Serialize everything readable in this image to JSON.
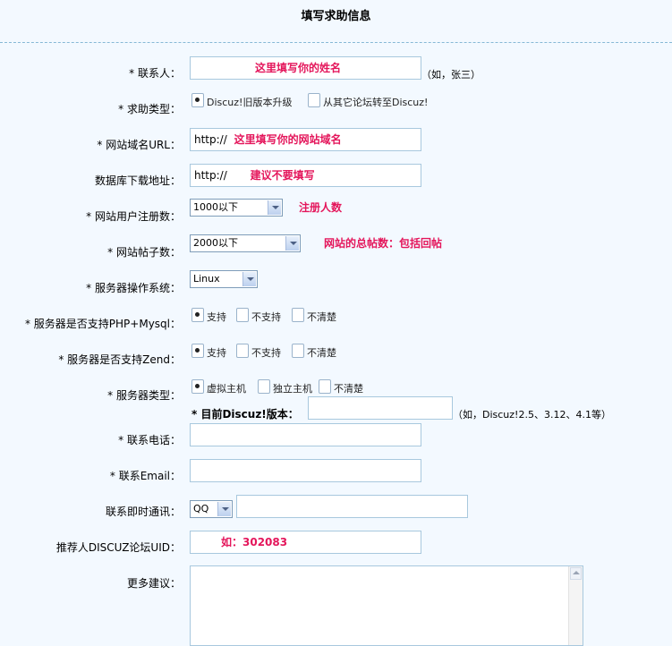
{
  "page": {
    "title": "填写求助信息"
  },
  "form": {
    "contact_name": {
      "label": "* 联系人：",
      "hint": "这里填写你的姓名",
      "note": "（如，张三）"
    },
    "help_type": {
      "label": "* 求助类型：",
      "options": [
        "Discuz!旧版本升级",
        "从其它论坛转至Discuz!"
      ],
      "selected": 0
    },
    "site_url": {
      "label": "* 网站域名URL：",
      "prefix": "http://",
      "hint": "这里填写你的网站域名"
    },
    "db_download": {
      "label": "数据库下载地址：",
      "prefix": "http://",
      "hint": "建议不要填写"
    },
    "user_count": {
      "label": "* 网站用户注册数：",
      "value": "1000以下",
      "hint": "注册人数"
    },
    "post_count": {
      "label": "* 网站帖子数：",
      "value": "2000以下",
      "hint": "网站的总帖数：包括回帖"
    },
    "os": {
      "label": "* 服务器操作系统：",
      "value": "Linux"
    },
    "php_mysql": {
      "label": "* 服务器是否支持PHP+Mysql：",
      "options": [
        "支持",
        "不支持",
        "不清楚"
      ],
      "selected": 0
    },
    "zend": {
      "label": "* 服务器是否支持Zend：",
      "options": [
        "支持",
        "不支持",
        "不清楚"
      ],
      "selected": 0
    },
    "server_type": {
      "label": "* 服务器类型：",
      "options": [
        "虚拟主机",
        "独立主机",
        "不清楚"
      ],
      "selected": 0
    },
    "discuz_version": {
      "label": "* 目前Discuz!版本：",
      "note": "（如，Discuz!2.5、3.12、4.1等）"
    },
    "phone": {
      "label": "* 联系电话："
    },
    "email": {
      "label": "* 联系Email："
    },
    "im": {
      "label": "联系即时通讯：",
      "value": "QQ"
    },
    "referrer": {
      "label": "推荐人DISCUZ论坛UID：",
      "hint": "如：302083"
    },
    "suggestion": {
      "label": "更多建议："
    }
  }
}
